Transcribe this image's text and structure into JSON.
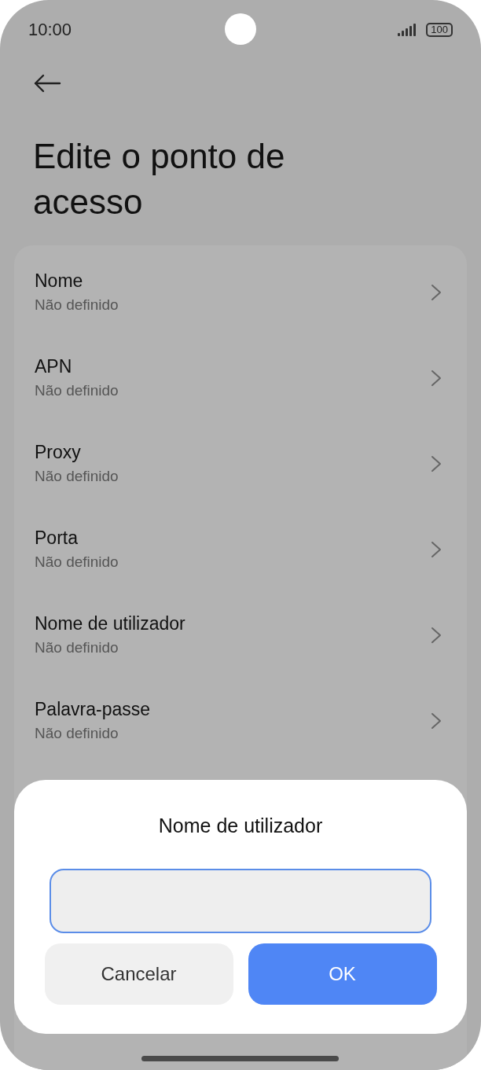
{
  "status_bar": {
    "time": "10:00",
    "battery": "100"
  },
  "header": {
    "title": "Edite o ponto de acesso"
  },
  "settings": [
    {
      "label": "Nome",
      "value": "Não definido"
    },
    {
      "label": "APN",
      "value": "Não definido"
    },
    {
      "label": "Proxy",
      "value": "Não definido"
    },
    {
      "label": "Porta",
      "value": "Não definido"
    },
    {
      "label": "Nome de utilizador",
      "value": "Não definido"
    },
    {
      "label": "Palavra-passe",
      "value": "Não definido"
    }
  ],
  "dialog": {
    "title": "Nome de utilizador",
    "input": {
      "focused": true
    },
    "buttons": [
      {
        "label": "Cancelar",
        "kind": "secondary"
      },
      {
        "label": "OK",
        "kind": "primary"
      }
    ]
  }
}
